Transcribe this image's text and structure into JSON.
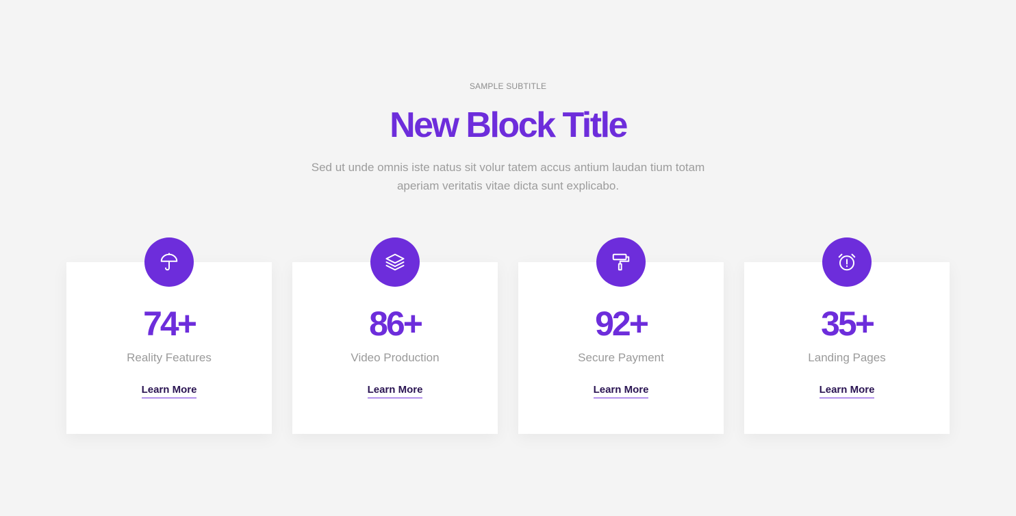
{
  "header": {
    "subtitle": "SAMPLE SUBTITLE",
    "title": "New Block Title",
    "description": "Sed ut unde omnis iste natus sit volur tatem accus antium laudan tium totam aperiam veritatis vitae dicta sunt explicabo."
  },
  "theme": {
    "accent": "#6d2ddb",
    "background": "#f4f4f4",
    "card_background": "#ffffff",
    "link_color": "#2a1452"
  },
  "cards": [
    {
      "icon": "umbrella-icon",
      "number": "74+",
      "label": "Reality Features",
      "link": "Learn More"
    },
    {
      "icon": "layers-icon",
      "number": "86+",
      "label": "Video Production",
      "link": "Learn More"
    },
    {
      "icon": "paint-roller-icon",
      "number": "92+",
      "label": "Secure Payment",
      "link": "Learn More"
    },
    {
      "icon": "alarm-clock-icon",
      "number": "35+",
      "label": "Landing Pages",
      "link": "Learn More"
    }
  ]
}
